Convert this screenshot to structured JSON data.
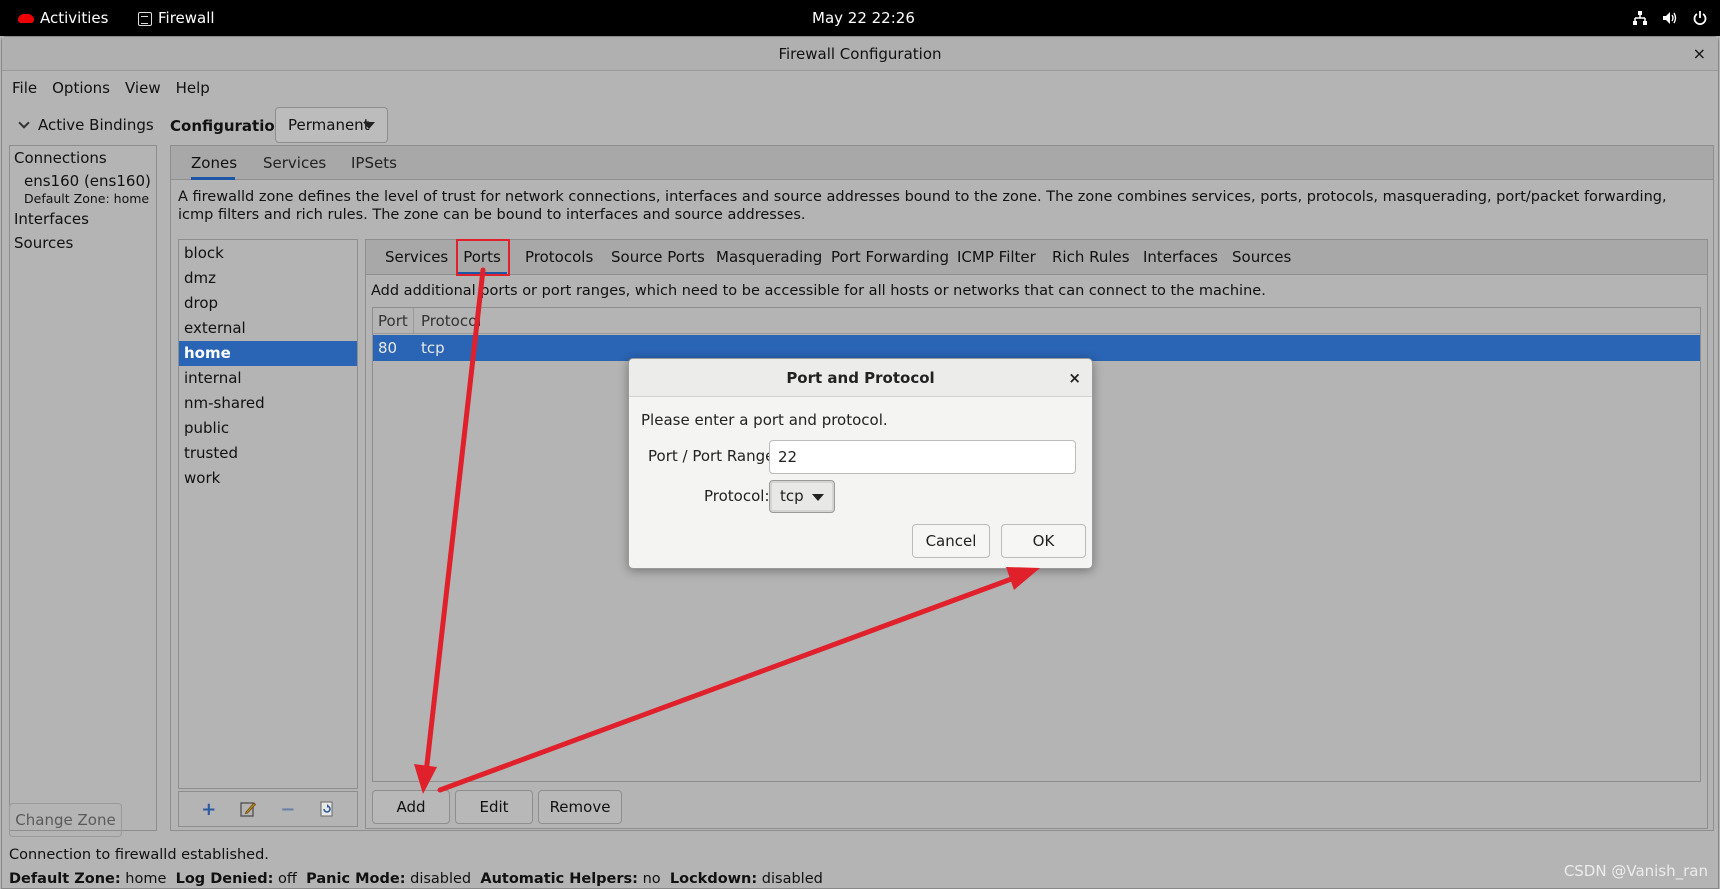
{
  "topbar": {
    "activities": "Activities",
    "app_name": "Firewall",
    "clock": "May 22  22:26",
    "network_icon": "network-icon",
    "volume_icon": "volume-icon",
    "power_icon": "power-icon"
  },
  "window": {
    "title": "Firewall Configuration",
    "close": "×"
  },
  "menu": [
    "File",
    "Options",
    "View",
    "Help"
  ],
  "active_bindings": {
    "header": "Active Bindings",
    "connections_label": "Connections",
    "connection_name": "ens160 (ens160)",
    "default_zone_text": "Default Zone: home",
    "interfaces_label": "Interfaces",
    "sources_label": "Sources",
    "change_zone": "Change Zone"
  },
  "configuration": {
    "label": "Configuration:",
    "value": "Permanent"
  },
  "top_tabs": [
    "Zones",
    "Services",
    "IPSets"
  ],
  "zone_description": "A firewalld zone defines the level of trust for network connections, interfaces and source addresses bound to the zone. The zone combines services, ports, protocols, masquerading, port/packet forwarding, icmp filters and rich rules. The zone can be bound to interfaces and source addresses.",
  "zones": [
    "block",
    "dmz",
    "drop",
    "external",
    "home",
    "internal",
    "nm-shared",
    "public",
    "trusted",
    "work"
  ],
  "selected_zone": "home",
  "zone_sub_tabs": [
    "Services",
    "Ports",
    "Protocols",
    "Source Ports",
    "Masquerading",
    "Port Forwarding",
    "ICMP Filter",
    "Rich Rules",
    "Interfaces",
    "Sources"
  ],
  "ports": {
    "description": "Add additional ports or port ranges, which need to be accessible for all hosts or networks that can connect to the machine.",
    "columns": [
      "Port",
      "Protocol"
    ],
    "rows": [
      {
        "port": "80",
        "protocol": "tcp"
      }
    ],
    "buttons": {
      "add": "Add",
      "edit": "Edit",
      "remove": "Remove"
    }
  },
  "dialog": {
    "title": "Port and Protocol",
    "close": "×",
    "prompt": "Please enter a port and protocol.",
    "port_label": "Port / Port Range:",
    "port_value": "22",
    "protocol_label": "Protocol:",
    "protocol_value": "tcp",
    "cancel": "Cancel",
    "ok": "OK"
  },
  "status": {
    "connection": "Connection to firewalld established.",
    "default_zone_label": "Default Zone:",
    "default_zone_value": "home",
    "log_denied_label": "Log Denied:",
    "log_denied_value": "off",
    "panic_label": "Panic Mode:",
    "panic_value": "disabled",
    "helpers_label": "Automatic Helpers:",
    "helpers_value": "no",
    "lockdown_label": "Lockdown:",
    "lockdown_value": "disabled"
  },
  "watermark": "CSDN @Vanish_ran",
  "annotation_color": "#e0202a",
  "selection_color": "#2a64b4"
}
